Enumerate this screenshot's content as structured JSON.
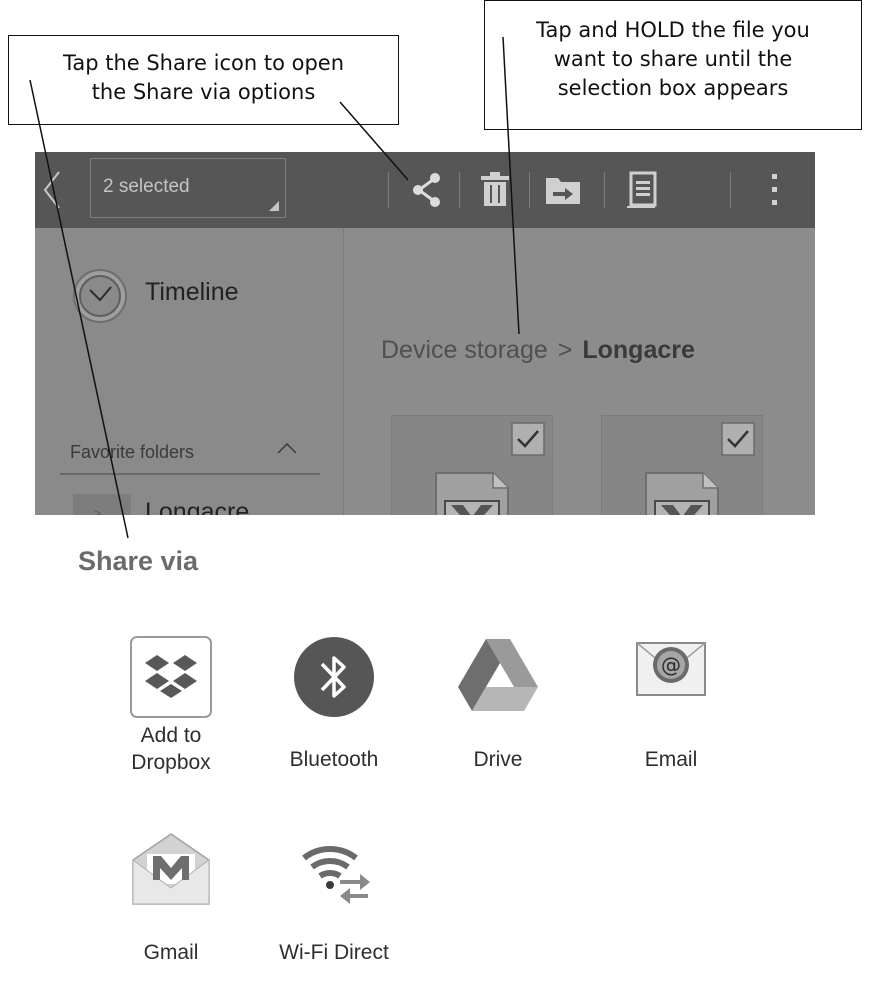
{
  "callouts": {
    "left": [
      "Tap the Share icon to open",
      "the Share via options"
    ],
    "right": [
      "Tap and HOLD the file you",
      "want to share until the",
      "selection box appears"
    ]
  },
  "action_bar": {
    "selected_count": "2 selected",
    "icons": [
      "back-icon",
      "share-icon",
      "delete-icon",
      "move-icon",
      "copy-icon",
      "overflow-menu-icon"
    ]
  },
  "sidebar": {
    "timeline_label": "Timeline",
    "favorites_header": "Favorite folders",
    "favorite_folders": [
      "Longacre"
    ]
  },
  "content": {
    "breadcrumb_root": "Device storage",
    "breadcrumb_separator": ">",
    "breadcrumb_current": "Longacre",
    "files": [
      {
        "icon": "excel-file-icon",
        "checked": true
      },
      {
        "icon": "excel-file-icon",
        "checked": true
      }
    ]
  },
  "share_sheet": {
    "title": "Share via",
    "options": [
      {
        "label_lines": [
          "Add to",
          "Dropbox"
        ],
        "icon": "dropbox-icon"
      },
      {
        "label": "Bluetooth",
        "icon": "bluetooth-icon"
      },
      {
        "label": "Drive",
        "icon": "drive-icon"
      },
      {
        "label": "Email",
        "icon": "email-icon"
      },
      {
        "label": "Gmail",
        "icon": "gmail-icon"
      },
      {
        "label": "Wi-Fi Direct",
        "icon": "wifi-direct-icon"
      }
    ]
  }
}
